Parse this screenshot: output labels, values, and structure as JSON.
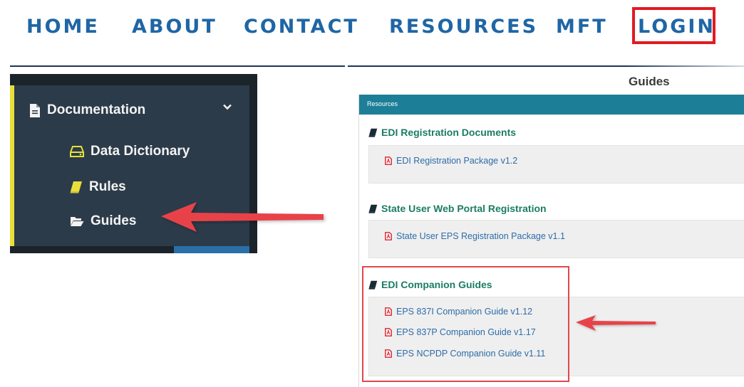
{
  "nav": {
    "home": "HOME",
    "about": "ABOUT",
    "contact": "CONTACT",
    "resources": "RESOURCES",
    "mft": "MFT",
    "login": "LOGIN"
  },
  "sidebar": {
    "documentation": "Documentation",
    "items": [
      {
        "label": "Data Dictionary",
        "icon": "hdd-icon"
      },
      {
        "label": "Rules",
        "icon": "book-icon"
      },
      {
        "label": "Guides",
        "icon": "folder-open-icon"
      }
    ]
  },
  "content": {
    "title": "Guides",
    "panel_header": "Resources",
    "sections": [
      {
        "title": "EDI Registration Documents",
        "links": [
          "EDI Registration Package v1.2"
        ]
      },
      {
        "title": "State User Web Portal Registration",
        "links": [
          "State User EPS Registration Package v1.1"
        ]
      },
      {
        "title": "EDI Companion Guides",
        "links": [
          "EPS 837I Companion Guide v1.12",
          "EPS 837P Companion Guide v1.17",
          "EPS NCPDP Companion Guide v1.11"
        ]
      }
    ]
  },
  "colors": {
    "nav_text": "#1f66a5",
    "highlight_red": "#e11b22",
    "sidebar_bg": "#2c3b49",
    "sidebar_accent": "#e8df3a",
    "panel_header": "#1d7f97",
    "section_title": "#1a7d62",
    "link": "#2d6ca8",
    "pdf_icon": "#d9232e",
    "arrow": "#e8424a"
  }
}
